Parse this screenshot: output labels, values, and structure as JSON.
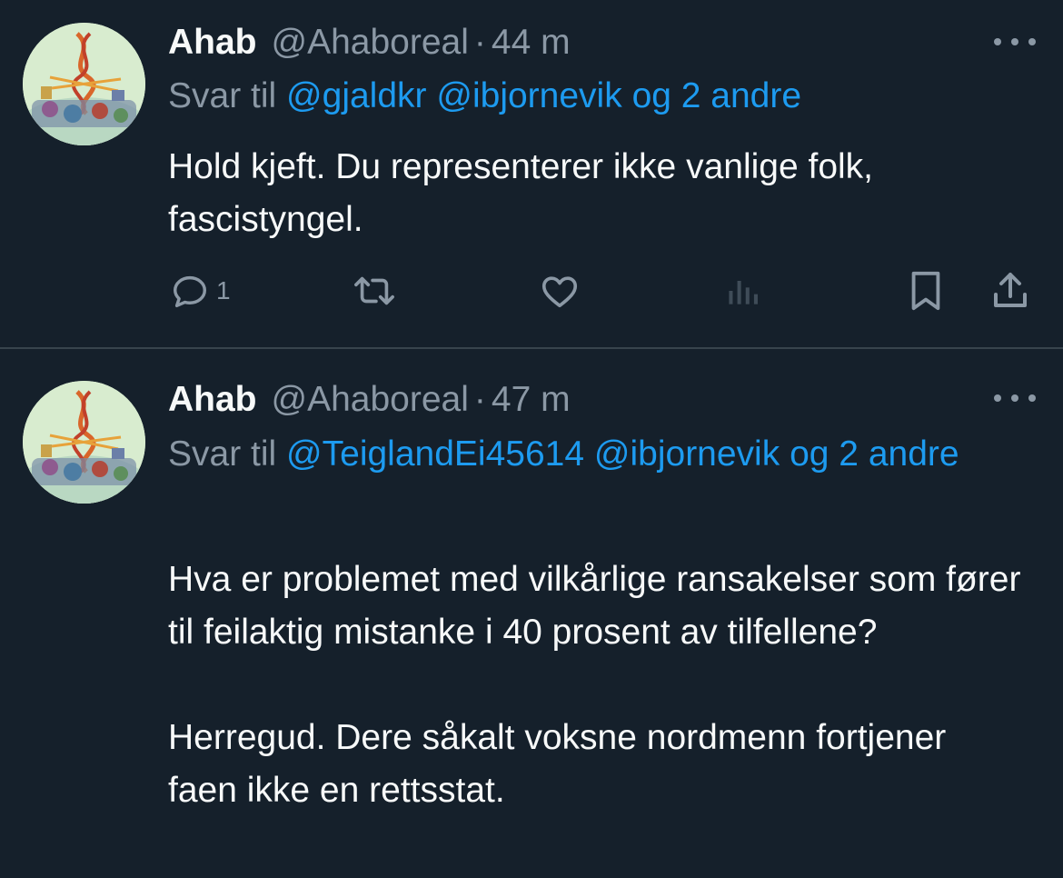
{
  "tweets": [
    {
      "display_name": "Ahab",
      "handle": "@Ahaboreal",
      "separator": "·",
      "time": "44 m",
      "reply_prefix": "Svar til",
      "reply_mentions": [
        "@gjaldkr",
        "@ibjornevik"
      ],
      "reply_suffix": "og 2 andre",
      "text": "Hold kjeft. Du representerer ikke vanlige folk, fascistyngel.",
      "reply_count": "1"
    },
    {
      "display_name": "Ahab",
      "handle": "@Ahaboreal",
      "separator": "·",
      "time": "47 m",
      "reply_prefix": "Svar til",
      "reply_mentions": [
        "@TeiglandEi45614",
        "@ibjornevik"
      ],
      "reply_suffix": "og 2 andre",
      "text": "Hva er problemet med vilkårlige ransakelser som fører til feilaktig mistanke i 40 prosent av tilfellene?\n\nHerregud. Dere såkalt voksne nordmenn fortjener faen ikke en rettsstat."
    }
  ],
  "icons": {
    "more": "more-horizontal-icon",
    "reply": "reply-icon",
    "retweet": "retweet-icon",
    "like": "like-icon",
    "views": "views-icon",
    "bookmark": "bookmark-icon",
    "share": "share-icon"
  },
  "colors": {
    "background": "#15202b",
    "text": "#f7f9f9",
    "secondary": "#8b98a5",
    "link": "#1d9bf0",
    "divider": "#38444d"
  }
}
